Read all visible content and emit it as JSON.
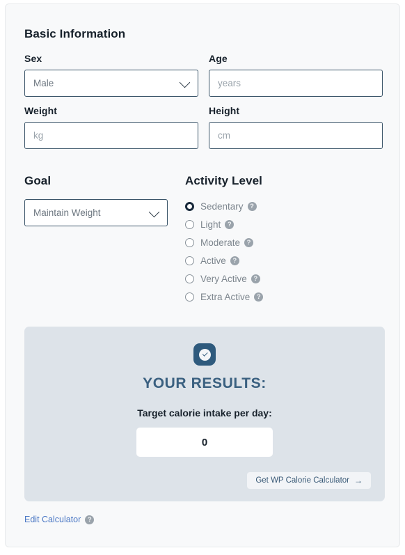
{
  "form": {
    "section_title": "Basic Information",
    "fields": [
      {
        "label": "Sex",
        "type": "select",
        "value": "Male",
        "name": "sex"
      },
      {
        "label": "Age",
        "type": "input",
        "placeholder": "years",
        "value": "",
        "name": "age"
      },
      {
        "label": "Weight",
        "type": "input",
        "placeholder": "kg",
        "value": "",
        "name": "weight"
      },
      {
        "label": "Height",
        "type": "input",
        "placeholder": "cm",
        "value": "",
        "name": "height"
      }
    ],
    "goal": {
      "label": "Goal",
      "value": "Maintain Weight"
    },
    "activity": {
      "label": "Activity Level",
      "options": [
        {
          "label": "Sedentary",
          "selected": true
        },
        {
          "label": "Light",
          "selected": false
        },
        {
          "label": "Moderate",
          "selected": false
        },
        {
          "label": "Active",
          "selected": false
        },
        {
          "label": "Very Active",
          "selected": false
        },
        {
          "label": "Extra Active",
          "selected": false
        }
      ],
      "help_glyph": "?"
    }
  },
  "results": {
    "badge_icon": "check-circle-icon",
    "title": "YOUR RESULTS:",
    "subtitle": "Target calorie intake per day:",
    "value": "0",
    "cta_label": "Get WP Calorie Calculator",
    "cta_arrow": "→"
  },
  "footer": {
    "edit_label": "Edit Calculator",
    "help_glyph": "?"
  },
  "colors": {
    "card_bg": "#f8f9fa",
    "input_border": "#3b5569",
    "results_bg": "#dde3e9",
    "badge": "#2e5a7d",
    "results_title": "#3a6080",
    "link": "#4a77c4",
    "muted_text": "#7d868e"
  }
}
